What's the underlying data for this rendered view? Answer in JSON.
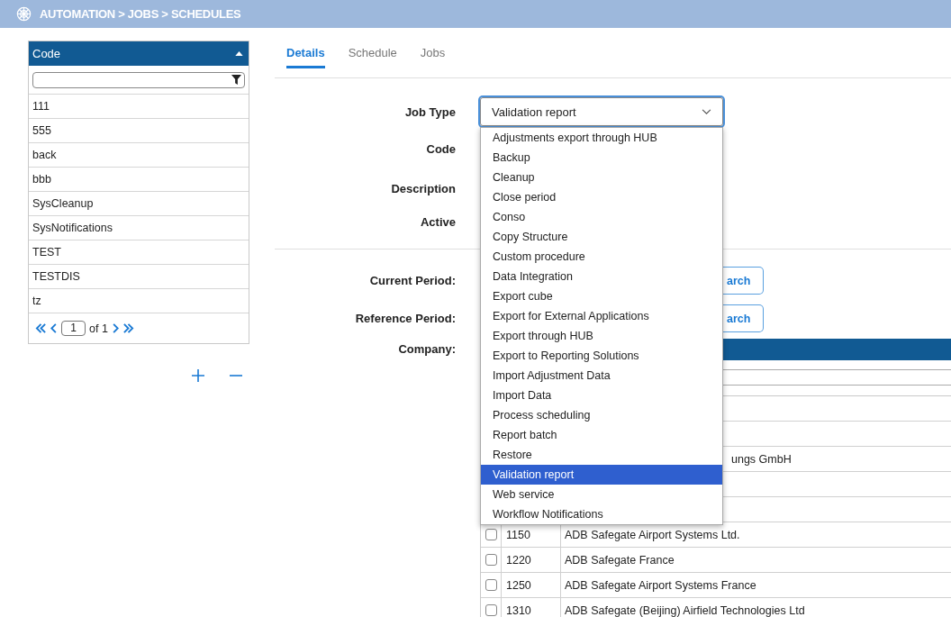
{
  "breadcrumb": "AUTOMATION > JOBS > SCHEDULES",
  "code_list": {
    "header": "Code",
    "rows": [
      "111",
      "555",
      "back",
      "bbb",
      "SysCleanup",
      "SysNotifications",
      "TEST",
      "TESTDIS",
      "tz"
    ],
    "pager": {
      "page": "1",
      "of_label": "of 1"
    }
  },
  "tabs": [
    {
      "label": "Details",
      "selected": true
    },
    {
      "label": "Schedule",
      "selected": false
    },
    {
      "label": "Jobs",
      "selected": false
    }
  ],
  "details": {
    "labels": [
      "Job Type",
      "Code",
      "Description",
      "Active"
    ],
    "job_type": {
      "value": "Validation report",
      "expanded": true,
      "options": [
        {
          "label": "Adjustments export through HUB",
          "selected": false
        },
        {
          "label": "Backup",
          "selected": false
        },
        {
          "label": "Cleanup",
          "selected": false
        },
        {
          "label": "Close period",
          "selected": false
        },
        {
          "label": "Conso",
          "selected": false
        },
        {
          "label": "Copy Structure",
          "selected": false
        },
        {
          "label": "Custom procedure",
          "selected": false
        },
        {
          "label": "Data Integration",
          "selected": false
        },
        {
          "label": "Export cube",
          "selected": false
        },
        {
          "label": "Export for External Applications",
          "selected": false
        },
        {
          "label": "Export through HUB",
          "selected": false
        },
        {
          "label": "Export to Reporting Solutions",
          "selected": false
        },
        {
          "label": "Import Adjustment Data",
          "selected": false
        },
        {
          "label": "Import Data",
          "selected": false
        },
        {
          "label": "Process scheduling",
          "selected": false
        },
        {
          "label": "Report batch",
          "selected": false
        },
        {
          "label": "Restore",
          "selected": false
        },
        {
          "label": "Validation report",
          "selected": true
        },
        {
          "label": "Web service",
          "selected": false
        },
        {
          "label": "Workflow Notifications",
          "selected": false
        }
      ]
    }
  },
  "periods": [
    {
      "label": "Current Period:",
      "button": "arch"
    },
    {
      "label": "Reference Period:",
      "button": "arch"
    }
  ],
  "company": {
    "label": "Company:",
    "rows": [
      {
        "kind": "covered"
      },
      {
        "kind": "covered"
      },
      {
        "kind": "covered",
        "text": "ungs GmbH"
      },
      {
        "kind": "covered"
      },
      {
        "kind": "covered"
      },
      {
        "kind": "full",
        "checked": false,
        "code": "1150",
        "name": "ADB Safegate Airport Systems Ltd."
      },
      {
        "kind": "full",
        "checked": false,
        "code": "1220",
        "name": "ADB Safegate France"
      },
      {
        "kind": "full",
        "checked": false,
        "code": "1250",
        "name": "ADB Safegate Airport Systems France"
      },
      {
        "kind": "full",
        "checked": false,
        "code": "1310",
        "name": "ADB Safegate (Beijing) Airfield Technologies Ltd"
      }
    ]
  }
}
